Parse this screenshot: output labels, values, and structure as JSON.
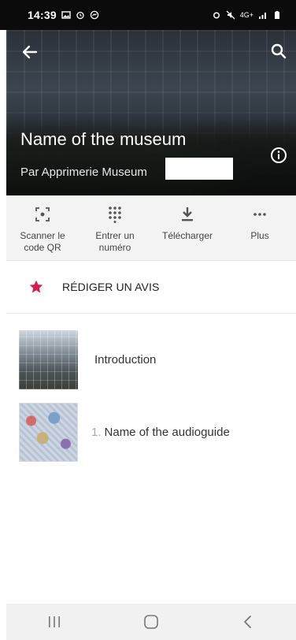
{
  "status_bar": {
    "time": "14:39",
    "network": "4G+"
  },
  "hero": {
    "title": "Name of the museum",
    "subtitle": "Par Apprimerie Museum"
  },
  "actions": [
    {
      "label": "Scanner le\ncode QR",
      "icon": "qr-scan-icon"
    },
    {
      "label": "Entrer un\nnuméro",
      "icon": "dialpad-icon"
    },
    {
      "label": "Télécharger",
      "icon": "download-icon"
    },
    {
      "label": "Plus",
      "icon": "more-icon"
    }
  ],
  "review": {
    "label": "RÉDIGER UN AVIS",
    "star_color": "#d81b4e"
  },
  "list": [
    {
      "number": "",
      "title": "Introduction"
    },
    {
      "number": "1.",
      "title": "Name of the audioguide"
    }
  ],
  "colors": {
    "accent": "#d81b4e",
    "status_bar": "#0b0b0b",
    "action_bar": "#f3f3f3"
  }
}
